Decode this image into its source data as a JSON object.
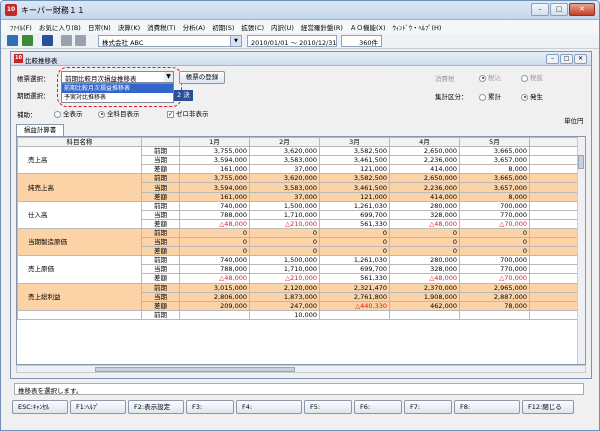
{
  "app": {
    "title": "キーパー財務１１",
    "icon_text": "10"
  },
  "window_buttons": {
    "minimize": "–",
    "maximize": "□",
    "close": "✕"
  },
  "menu": [
    "ﾌｧｲﾙ(F)",
    "お気に入り(B)",
    "日常(N)",
    "決算(K)",
    "消費税(T)",
    "分析(A)",
    "初期(S)",
    "拡張(C)",
    "内訳(U)",
    "経営羅針盤(R)",
    "ＡＯ機能(X)",
    "ｳｨﾝﾄﾞｳ・ﾍﾙﾌﾟ(H)"
  ],
  "toolbar": {
    "company": "株式会社 ABC",
    "period": "2010/01/01 〜 2010/12/31",
    "count": "360件"
  },
  "child": {
    "title": "比較推移表",
    "icon_text": "10"
  },
  "form": {
    "report_label": "帳票選択：",
    "report_value": "前期比較月次損益推移表",
    "dropdown_options": [
      "前期比較月次損益推移表",
      "予実対比推移表"
    ],
    "register_button": "帳票の登録",
    "period_label": "期間選択：",
    "period_partial": "2 決",
    "aux_label": "補助：",
    "all_display": "全表示",
    "all_display2": "全科目表示",
    "zero_hide": "ゼロ非表示",
    "tax_label": "消費税",
    "tax_in": "税込",
    "tax_out": "税抜",
    "agg_label": "集計区分：",
    "agg_cum": "累計",
    "agg_occ": "発生",
    "unit": "単位円",
    "tab": "損益計算書"
  },
  "table": {
    "headers": [
      "科目名称",
      "",
      "1月",
      "2月",
      "3月",
      "4月",
      "5月"
    ],
    "groups": [
      {
        "name": "売上高",
        "alt": false,
        "rows": [
          [
            "前期",
            "3,755,000",
            "3,620,000",
            "3,582,500",
            "2,650,000",
            "3,665,000"
          ],
          [
            "当期",
            "3,594,000",
            "3,583,000",
            "3,461,500",
            "2,236,000",
            "3,657,000"
          ],
          [
            "差額",
            "161,000",
            "37,000",
            "121,000",
            "414,000",
            "8,000"
          ]
        ]
      },
      {
        "name": "純売上高",
        "alt": true,
        "rows": [
          [
            "前期",
            "3,755,000",
            "3,620,000",
            "3,582,500",
            "2,650,000",
            "3,665,000"
          ],
          [
            "当期",
            "3,594,000",
            "3,583,000",
            "3,461,500",
            "2,236,000",
            "3,657,000"
          ],
          [
            "差額",
            "161,000",
            "37,000",
            "121,000",
            "414,000",
            "8,000"
          ]
        ]
      },
      {
        "name": "仕入高",
        "alt": false,
        "rows": [
          [
            "前期",
            "740,000",
            "1,500,000",
            "1,261,030",
            "280,000",
            "700,000"
          ],
          [
            "当期",
            "788,000",
            "1,710,000",
            "699,700",
            "328,000",
            "770,000"
          ],
          [
            "差額",
            "△48,000",
            "△210,000",
            "561,330",
            "△48,000",
            "△70,000"
          ]
        ]
      },
      {
        "name": "当期製造原価",
        "alt": true,
        "rows": [
          [
            "前期",
            "0",
            "0",
            "0",
            "0",
            "0"
          ],
          [
            "当期",
            "0",
            "0",
            "0",
            "0",
            "0"
          ],
          [
            "差額",
            "0",
            "0",
            "0",
            "0",
            "0"
          ]
        ]
      },
      {
        "name": "売上原価",
        "alt": false,
        "rows": [
          [
            "前期",
            "740,000",
            "1,500,000",
            "1,261,030",
            "280,000",
            "700,000"
          ],
          [
            "当期",
            "788,000",
            "1,710,000",
            "699,700",
            "328,000",
            "770,000"
          ],
          [
            "差額",
            "△48,000",
            "△210,000",
            "561,330",
            "△48,000",
            "△70,000"
          ]
        ]
      },
      {
        "name": "売上総利益",
        "alt": true,
        "rows": [
          [
            "前期",
            "3,015,000",
            "2,120,000",
            "2,321,470",
            "2,370,000",
            "2,965,000"
          ],
          [
            "当期",
            "2,806,000",
            "1,873,000",
            "2,761,800",
            "1,908,000",
            "2,887,000"
          ],
          [
            "差額",
            "209,000",
            "247,000",
            "△440,330",
            "462,000",
            "78,000"
          ]
        ]
      },
      {
        "name": "",
        "alt": false,
        "rows": [
          [
            "前期",
            "",
            "10,000",
            "",
            "",
            ""
          ]
        ]
      }
    ]
  },
  "status_text": "推移表を選択します。",
  "fkeys": [
    "ESC:ｷｬﾝｾﾙ",
    "F1:ﾍﾙﾌﾟ",
    "F2:表示設定",
    "F3:",
    "F4:",
    "F5:",
    "F6:",
    "F7:",
    "F8:",
    "F12:閉じる"
  ]
}
